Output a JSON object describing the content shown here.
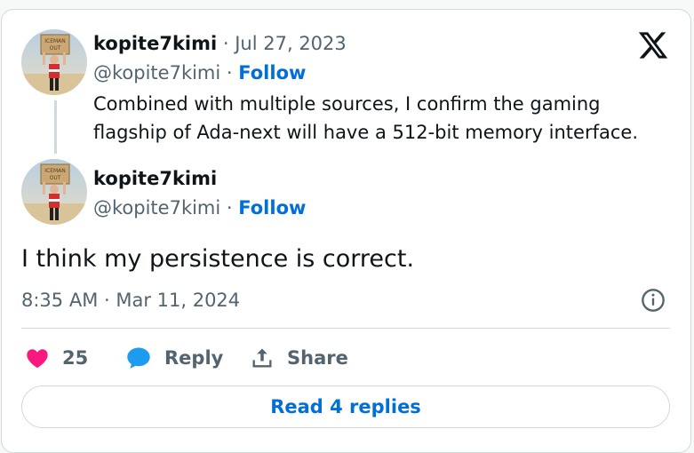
{
  "quoted_tweet": {
    "display_name": "kopite7kimi",
    "separator": " · ",
    "date": "Jul 27, 2023",
    "handle": "@kopite7kimi",
    "dot": " · ",
    "follow_label": "Follow",
    "text": "Combined with multiple sources, I confirm the gaming flagship of Ada-next will have a 512-bit memory interface."
  },
  "main_tweet": {
    "display_name": "kopite7kimi",
    "handle": "@kopite7kimi",
    "dot": " · ",
    "follow_label": "Follow",
    "text": "I think my persistence is correct.",
    "timestamp": "8:35 AM · Mar 11, 2024"
  },
  "actions": {
    "like_count": "25",
    "reply_label": "Reply",
    "share_label": "Share"
  },
  "read_replies_label": "Read 4 replies",
  "avatar_sign_text": "ICEMAN OUT",
  "colors": {
    "like": "#f91880",
    "reply": "#1d9bf0",
    "link": "#006fd6",
    "text": "#0f1419",
    "muted": "#536471",
    "border": "#cfd9de"
  },
  "icons": {
    "platform": "x-logo-icon",
    "like": "heart-icon",
    "reply": "speech-bubble-icon",
    "share": "share-upload-icon",
    "info": "info-icon"
  }
}
